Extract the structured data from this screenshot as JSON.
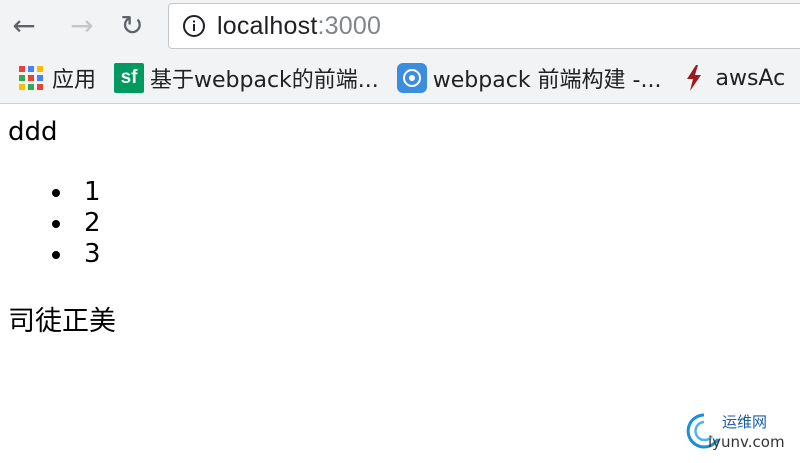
{
  "browser": {
    "url_host": "localhost",
    "url_port": ":3000",
    "nav": {
      "back_glyph": "←",
      "forward_glyph": "→",
      "reload_glyph": "↻"
    },
    "bookmarks": [
      {
        "label": "应用",
        "icon": "apps-grid-icon"
      },
      {
        "label": "基于webpack的前端...",
        "icon": "sf-icon",
        "icon_text": "sf"
      },
      {
        "label": "webpack 前端构建 -...",
        "icon": "webpack-icon"
      },
      {
        "label": "awsAc",
        "icon": "lightning-icon"
      }
    ]
  },
  "page": {
    "heading": "ddd",
    "list_items": [
      "1",
      "2",
      "3"
    ],
    "name": "司徒正美"
  },
  "watermark": {
    "cn": "运维网",
    "en": "iyunv.com"
  },
  "colors": {
    "chrome_bg": "#f1f3f4",
    "sf_green": "#009a61",
    "webpack_blue": "#3b8dde",
    "aws_red": "#9b1b1f"
  }
}
